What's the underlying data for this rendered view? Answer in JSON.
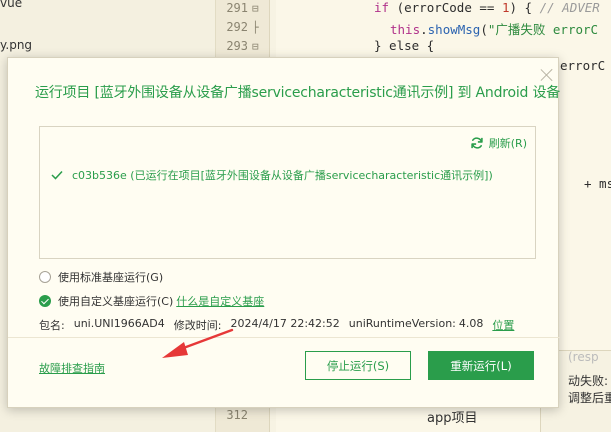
{
  "background": {
    "files": [
      "vue",
      "y.png"
    ],
    "line_numbers": [
      "291",
      "292",
      "293",
      "312"
    ],
    "code": {
      "line291": {
        "kw": "if",
        "rest1": " (errorCode == ",
        "num": "1",
        "rest2": ") { ",
        "cmt": "// ADVER"
      },
      "line292": {
        "kw": "this",
        "dot": ".",
        "fn": "showMsg",
        "open": "(",
        "str": "\"广播失败 errorC",
        "tail": ""
      },
      "line293": {
        "text": "} else {"
      },
      "side1": "errorC",
      "side2": "+ ms"
    },
    "panel_lines": [
      "(resp",
      "动失败:",
      "调整后重"
    ],
    "bottom_text": "app项目"
  },
  "dialog": {
    "title": "运行项目 [蓝牙外围设备从设备广播servicecharacteristic通讯示例] 到 Android 设备",
    "refresh_label": "刷新(R)",
    "device_text": "c03b536e (已运行在项目[蓝牙外围设备从设备广播servicecharacteristic通讯示例])",
    "radio_standard": "使用标准基座运行(G)",
    "radio_custom": "使用自定义基座运行(C)",
    "what_is_custom": "什么是自定义基座",
    "package_label": "包名:",
    "package_value": "uni.UNI1966AD4",
    "modified_label": "修改时间:",
    "modified_value": "2024/4/17 22:42:52",
    "runtime_label": "uniRuntimeVersion:",
    "runtime_value": "4.08",
    "location_link": "位置",
    "troubleshoot_link": "故障排查指南",
    "stop_button": "停止运行(S)",
    "rerun_button": "重新运行(L)",
    "accent_color": "#2a9d4b",
    "annotation_color": "#e63838"
  }
}
